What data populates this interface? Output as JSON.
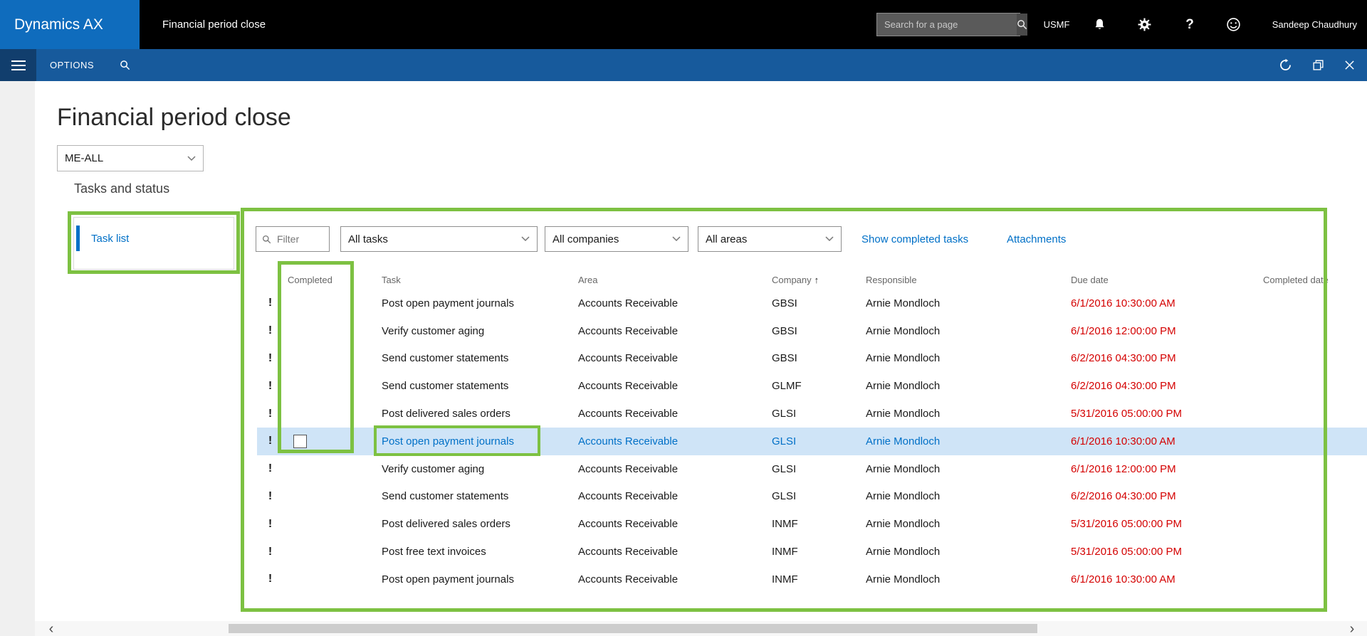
{
  "colors": {
    "brand_blue": "#0f6cbd",
    "menubar_blue": "#175a9c",
    "link_blue": "#0070c7",
    "selection_blue": "#cfe4f7",
    "due_date_red": "#d40000",
    "annotation_green": "#7dc142"
  },
  "topbar": {
    "brand": "Dynamics AX",
    "page_title": "Financial period close",
    "search_placeholder": "Search for a page",
    "company": "USMF",
    "user": "Sandeep Chaudhury"
  },
  "menubar": {
    "options_label": "OPTIONS"
  },
  "page": {
    "title": "Financial period close",
    "scope_selector": "ME-ALL",
    "section_title": "Tasks and status",
    "sidebar": {
      "task_list_label": "Task list"
    },
    "toolbar": {
      "filter_placeholder": "Filter",
      "tasks_filter": "All tasks",
      "companies_filter": "All companies",
      "areas_filter": "All areas",
      "show_completed_label": "Show completed tasks",
      "attachments_label": "Attachments"
    },
    "table": {
      "headers": [
        "Completed",
        "Task",
        "Area",
        "Company",
        "Responsible",
        "Due date",
        "Completed date"
      ],
      "sorted_by": "Company",
      "sort_direction": "ascending",
      "sort_arrow": "↑",
      "overdue_icon": "!",
      "selected_index": 5,
      "rows": [
        {
          "completed": false,
          "task": "Post open payment journals",
          "area": "Accounts Receivable",
          "company": "GBSI",
          "responsible": "Arnie Mondloch",
          "due_date": "6/1/2016 10:30:00 AM",
          "completed_date": ""
        },
        {
          "completed": false,
          "task": "Verify customer aging",
          "area": "Accounts Receivable",
          "company": "GBSI",
          "responsible": "Arnie Mondloch",
          "due_date": "6/1/2016 12:00:00 PM",
          "completed_date": ""
        },
        {
          "completed": false,
          "task": "Send customer statements",
          "area": "Accounts Receivable",
          "company": "GBSI",
          "responsible": "Arnie Mondloch",
          "due_date": "6/2/2016 04:30:00 PM",
          "completed_date": ""
        },
        {
          "completed": false,
          "task": "Send customer statements",
          "area": "Accounts Receivable",
          "company": "GLMF",
          "responsible": "Arnie Mondloch",
          "due_date": "6/2/2016 04:30:00 PM",
          "completed_date": ""
        },
        {
          "completed": false,
          "task": "Post delivered sales orders",
          "area": "Accounts Receivable",
          "company": "GLSI",
          "responsible": "Arnie Mondloch",
          "due_date": "5/31/2016 05:00:00 PM",
          "completed_date": ""
        },
        {
          "completed": false,
          "task": "Post open payment journals",
          "area": "Accounts Receivable",
          "company": "GLSI",
          "responsible": "Arnie Mondloch",
          "due_date": "6/1/2016 10:30:00 AM",
          "completed_date": ""
        },
        {
          "completed": false,
          "task": "Verify customer aging",
          "area": "Accounts Receivable",
          "company": "GLSI",
          "responsible": "Arnie Mondloch",
          "due_date": "6/1/2016 12:00:00 PM",
          "completed_date": ""
        },
        {
          "completed": false,
          "task": "Send customer statements",
          "area": "Accounts Receivable",
          "company": "GLSI",
          "responsible": "Arnie Mondloch",
          "due_date": "6/2/2016 04:30:00 PM",
          "completed_date": ""
        },
        {
          "completed": false,
          "task": "Post delivered sales orders",
          "area": "Accounts Receivable",
          "company": "INMF",
          "responsible": "Arnie Mondloch",
          "due_date": "5/31/2016 05:00:00 PM",
          "completed_date": ""
        },
        {
          "completed": false,
          "task": "Post free text invoices",
          "area": "Accounts Receivable",
          "company": "INMF",
          "responsible": "Arnie Mondloch",
          "due_date": "5/31/2016 05:00:00 PM",
          "completed_date": ""
        },
        {
          "completed": false,
          "task": "Post open payment journals",
          "area": "Accounts Receivable",
          "company": "INMF",
          "responsible": "Arnie Mondloch",
          "due_date": "6/1/2016 10:30:00 AM",
          "completed_date": ""
        }
      ]
    },
    "scrollbar": {
      "left_arrow": "‹",
      "right_arrow": "›"
    }
  }
}
